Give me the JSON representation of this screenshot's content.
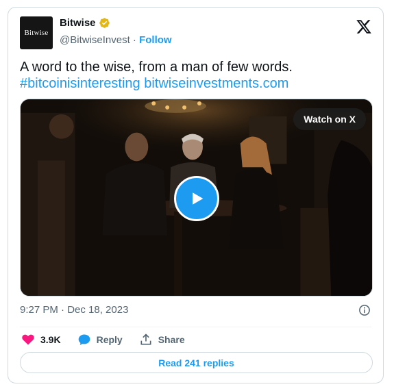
{
  "author": {
    "avatar_text": "Bitwise",
    "name": "Bitwise",
    "handle": "@BitwiseInvest",
    "separator": " · ",
    "follow_label": "Follow"
  },
  "tweet": {
    "text": "A word to the wise, from a man of few words.",
    "hashtag": "#bitcoinisinteresting",
    "link": "bitwiseinvestments.com"
  },
  "media": {
    "watch_label": "Watch on X"
  },
  "meta": {
    "time": "9:27 PM · Dec 18, 2023"
  },
  "actions": {
    "likes": "3.9K",
    "reply_label": "Reply",
    "share_label": "Share"
  },
  "read_replies_label": "Read 241 replies",
  "colors": {
    "accent": "#1d9bf0",
    "like": "#f91880",
    "verified": "#e2b719",
    "secondary_text": "#536471",
    "border": "#cfd9de"
  },
  "icons": [
    "x-logo-icon",
    "verified-badge-icon",
    "play-icon",
    "info-icon",
    "heart-icon",
    "reply-bubble-icon",
    "share-icon"
  ]
}
